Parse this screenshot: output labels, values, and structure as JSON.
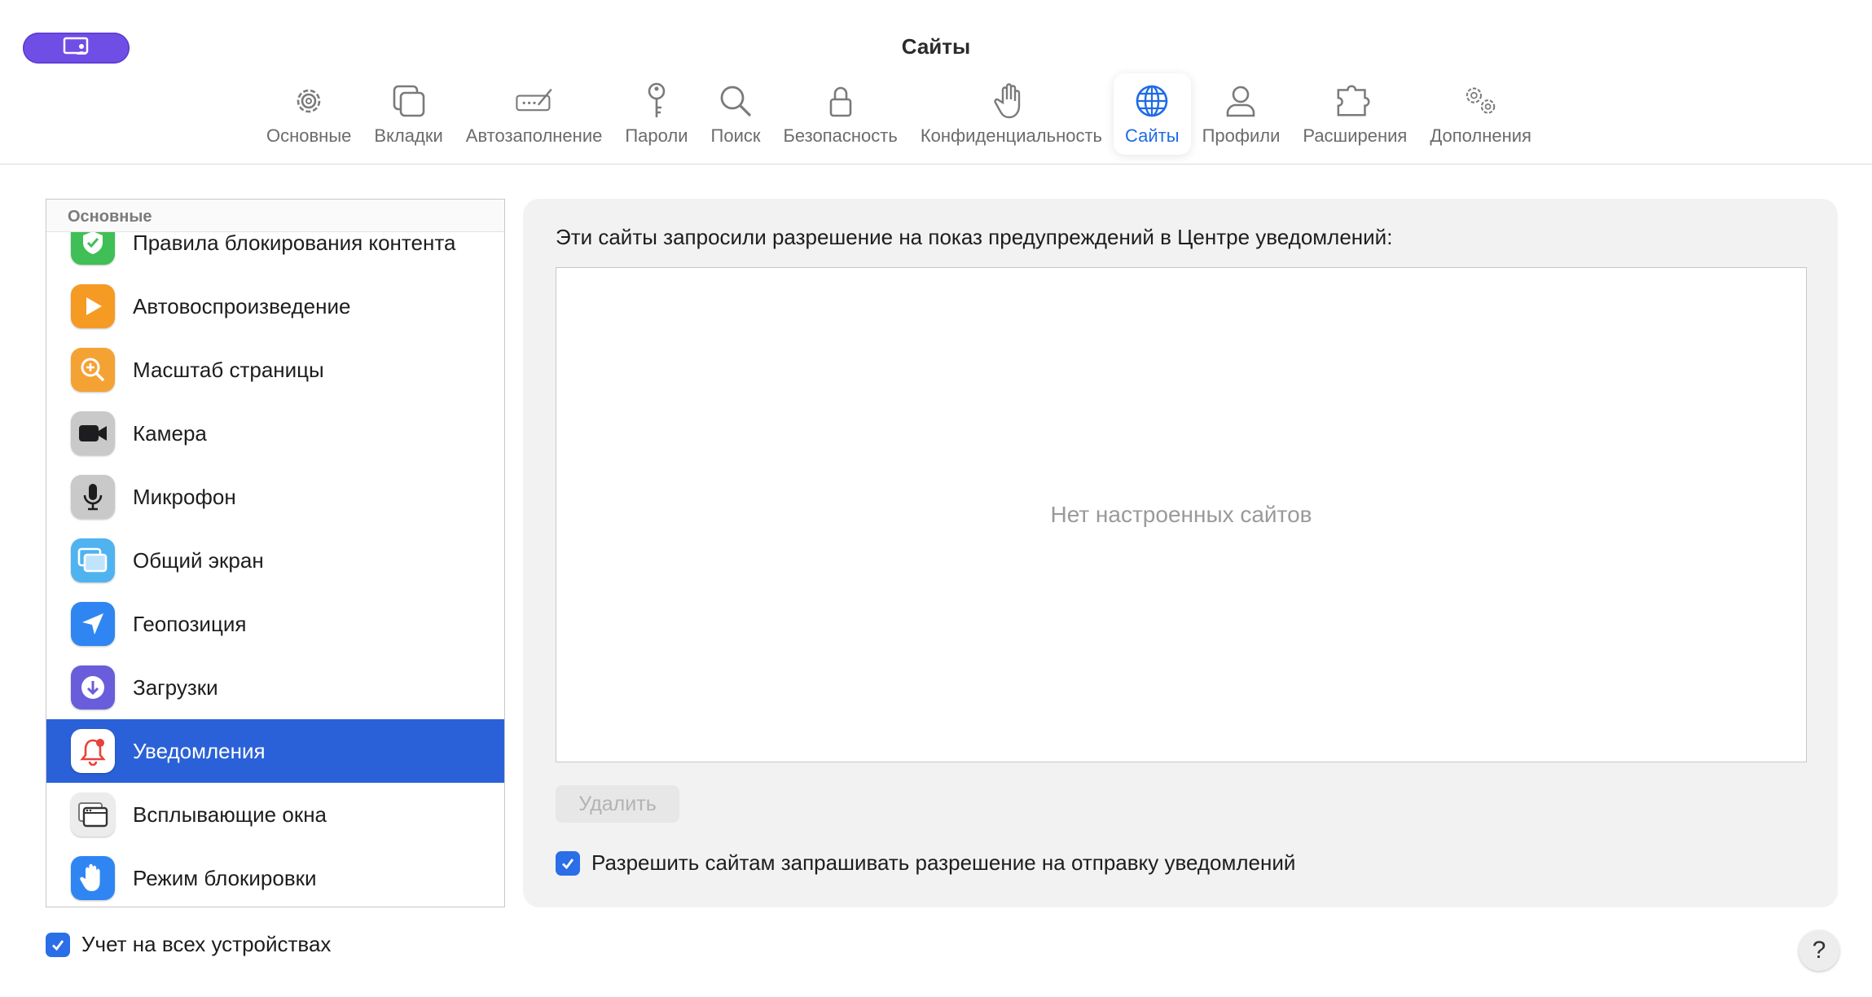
{
  "window": {
    "title": "Сайты"
  },
  "toolbar": {
    "items": [
      {
        "label": "Основные",
        "icon": "gear-icon"
      },
      {
        "label": "Вкладки",
        "icon": "tabs-icon"
      },
      {
        "label": "Автозаполнение",
        "icon": "autofill-icon"
      },
      {
        "label": "Пароли",
        "icon": "key-icon"
      },
      {
        "label": "Поиск",
        "icon": "magnifier-icon"
      },
      {
        "label": "Безопасность",
        "icon": "lock-icon"
      },
      {
        "label": "Конфиденциальность",
        "icon": "hand-icon"
      },
      {
        "label": "Сайты",
        "icon": "globe-icon",
        "active": true
      },
      {
        "label": "Профили",
        "icon": "person-icon"
      },
      {
        "label": "Расширения",
        "icon": "puzzle-icon"
      },
      {
        "label": "Дополнения",
        "icon": "gears-icon"
      }
    ]
  },
  "sidebar": {
    "header": "Основные",
    "items": [
      {
        "label": "Правила блокирования контента",
        "icon": "content-blocker-icon"
      },
      {
        "label": "Автовоспроизведение",
        "icon": "autoplay-icon"
      },
      {
        "label": "Масштаб страницы",
        "icon": "zoom-icon"
      },
      {
        "label": "Камера",
        "icon": "camera-icon"
      },
      {
        "label": "Микрофон",
        "icon": "microphone-icon"
      },
      {
        "label": "Общий экран",
        "icon": "screen-share-icon"
      },
      {
        "label": "Геопозиция",
        "icon": "location-icon"
      },
      {
        "label": "Загрузки",
        "icon": "download-icon"
      },
      {
        "label": "Уведомления",
        "icon": "bell-icon",
        "selected": true
      },
      {
        "label": "Всплывающие окна",
        "icon": "popup-window-icon"
      },
      {
        "label": "Режим блокировки",
        "icon": "lockdown-hand-icon"
      }
    ],
    "sync_label": "Учет на всех устройствах",
    "sync_checked": true
  },
  "content": {
    "heading": "Эти сайты запросили разрешение на показ предупреждений в Центре уведомлений:",
    "empty_text": "Нет настроенных сайтов",
    "delete_label": "Удалить",
    "allow_label": "Разрешить сайтам запрашивать разрешение на отправку уведомлений",
    "allow_checked": true
  },
  "help": {
    "label": "?"
  },
  "colors": {
    "accent": "#2b61d8",
    "profile": "#6f4ee6",
    "active_label": "#1e6be6"
  }
}
